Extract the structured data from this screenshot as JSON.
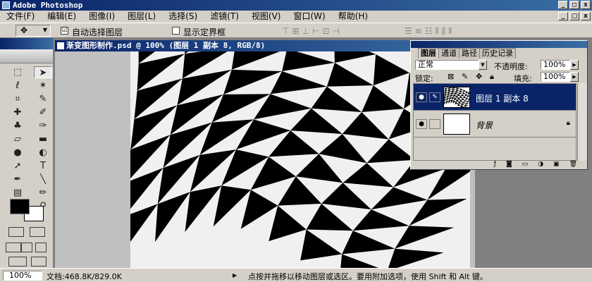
{
  "app": {
    "title": "Adobe Photoshop"
  },
  "window_buttons": {
    "minimize": "_",
    "maximize": "□",
    "close": "x"
  },
  "menu": [
    {
      "label": "文件(F)"
    },
    {
      "label": "编辑(E)"
    },
    {
      "label": "图像(I)"
    },
    {
      "label": "图层(L)"
    },
    {
      "label": "选择(S)"
    },
    {
      "label": "滤镜(T)"
    },
    {
      "label": "视图(V)"
    },
    {
      "label": "窗口(W)"
    },
    {
      "label": "帮助(H)"
    }
  ],
  "options": {
    "auto_select_label": "自动选择图层",
    "auto_select_checked": "☑",
    "show_bounds_label": "显示定界框",
    "show_bounds_checked": ""
  },
  "document": {
    "title": "渐变图形制作.psd @ 100% (图层 1 副本 8, RGB/8)"
  },
  "layers_panel": {
    "tabs": [
      {
        "label": "图层"
      },
      {
        "label": "通道"
      },
      {
        "label": "路径"
      },
      {
        "label": "历史记录"
      }
    ],
    "blend_mode": "正常",
    "opacity_label": "不透明度:",
    "opacity_value": "100%",
    "lock_label": "锁定:",
    "fill_label": "填充:",
    "fill_value": "100%",
    "layers": [
      {
        "name": "图层 1 副本 8",
        "selected": true
      },
      {
        "name": "背景",
        "selected": false
      }
    ]
  },
  "status": {
    "zoom": "100%",
    "doc_size": "文档:468.8K/829.0K",
    "hint": "点按并拖移以移动图层或选区。要用附加选项，使用 Shift 和 Alt 键。"
  },
  "colors": {
    "title_bar": "#0a246a",
    "panel_bg": "#d4d0c8",
    "foreground_color": "#000000",
    "background_color": "#ffffff"
  }
}
